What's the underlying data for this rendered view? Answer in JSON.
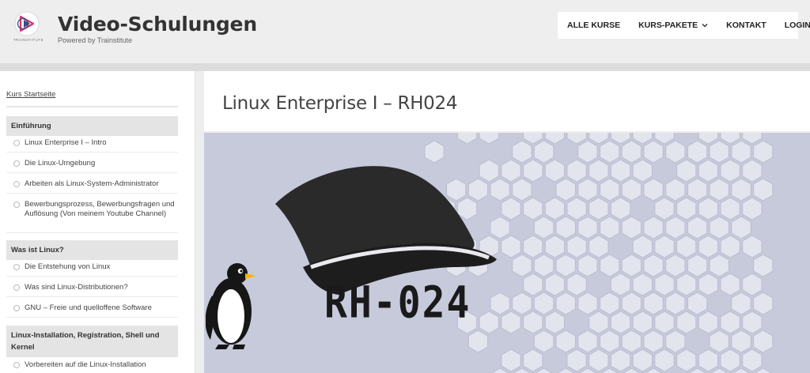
{
  "header": {
    "logo_text": "TRAINSTITUTE",
    "title": "Video-Schulungen",
    "subtitle": "Powered by Trainstitute"
  },
  "nav": {
    "items": [
      {
        "label": "ALLE KURSE"
      },
      {
        "label": "KURS-PAKETE",
        "has_dropdown": true
      },
      {
        "label": "KONTAKT"
      },
      {
        "label": "LOGIN"
      }
    ]
  },
  "sidebar": {
    "home_link": "Kurs Startseite",
    "sections": [
      {
        "title": "Einführung",
        "lessons": [
          "Linux Enterprise I – Intro",
          "Die Linux-Umgebung",
          "Arbeiten als Linux-System-Administrator",
          "Bewerbungsprozess, Bewerbungsfragen und Auflösung (Von meinem Youtube Channel)"
        ]
      },
      {
        "title": "Was ist Linux?",
        "lessons": [
          "Die Entstehung von Linux",
          "Was sind Linux-Distributionen?",
          "GNU – Freie und quelloffene Software"
        ]
      },
      {
        "title": "Linux-Installation, Registration, Shell und Kernel",
        "lessons": [
          "Vorbereiten auf die Linux-Installation"
        ]
      }
    ]
  },
  "main": {
    "title": "Linux Enterprise I – RH024",
    "hero_label": "RH-024"
  },
  "colors": {
    "hero_background": "#c6cadb",
    "logo_accent": "#d9346a",
    "hexagon_fill": "#e3e5ee"
  },
  "icons": [
    "play-logo-icon",
    "chevron-down-icon",
    "lesson-circle-icon",
    "penguin-icon",
    "hat-icon"
  ]
}
